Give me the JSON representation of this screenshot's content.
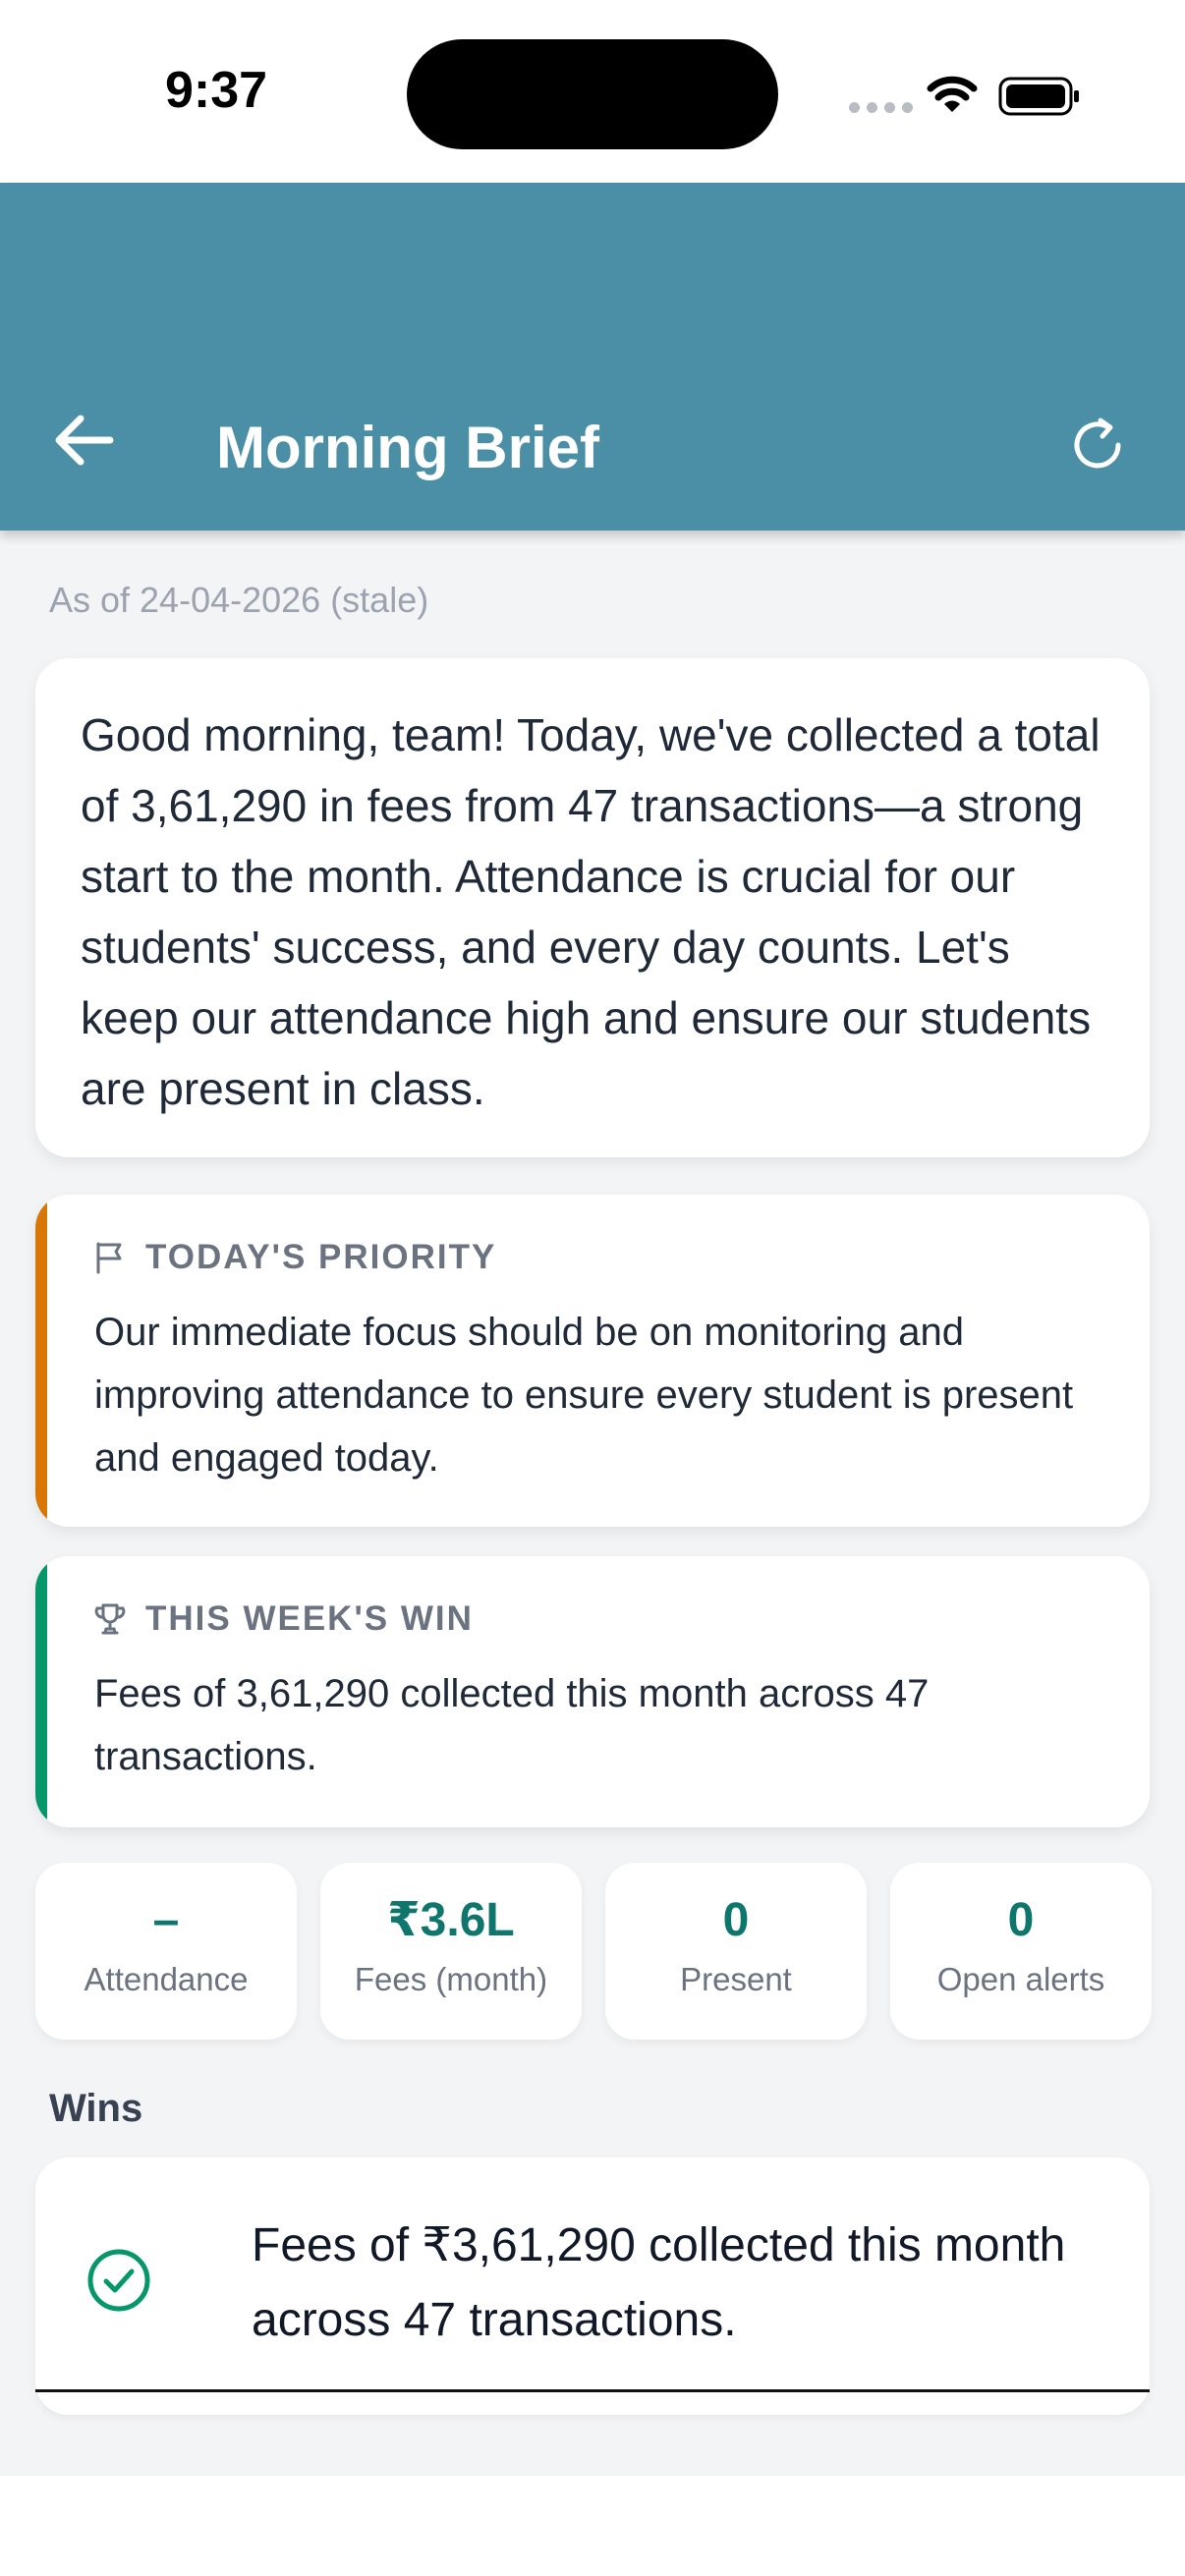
{
  "status_bar": {
    "time": "9:37"
  },
  "app_bar": {
    "title": "Morning Brief",
    "back_icon": "arrow-left-icon",
    "refresh_icon": "refresh-icon",
    "background_color": "#4a8fa5"
  },
  "as_of": "As of 24-04-2026 (stale)",
  "summary": {
    "text": "Good morning, team! Today, we've collected a total of 3,61,290 in fees from 47 transactions—a strong start to the month. Attendance is crucial for our students' success, and every day counts. Let's keep our attendance high and ensure our students are present in class."
  },
  "priority": {
    "icon": "flag-icon",
    "label": "TODAY'S PRIORITY",
    "text": "Our immediate focus should be on monitoring and improving attendance to ensure every student is present and engaged today.",
    "accent_color": "#d97706"
  },
  "weekly_win": {
    "icon": "trophy-icon",
    "label": "THIS WEEK'S WIN",
    "text": "Fees of 3,61,290 collected this month across 47 transactions.",
    "accent_color": "#059669"
  },
  "stats": [
    {
      "value": "–",
      "label": "Attendance"
    },
    {
      "value": "₹3.6L",
      "label": "Fees (month)"
    },
    {
      "value": "0",
      "label": "Present"
    },
    {
      "value": "0",
      "label": "Open alerts"
    }
  ],
  "wins": {
    "heading": "Wins",
    "items": [
      {
        "icon": "check-circle-icon",
        "text": "Fees of ₹3,61,290 collected this month across 47 transactions."
      }
    ]
  }
}
